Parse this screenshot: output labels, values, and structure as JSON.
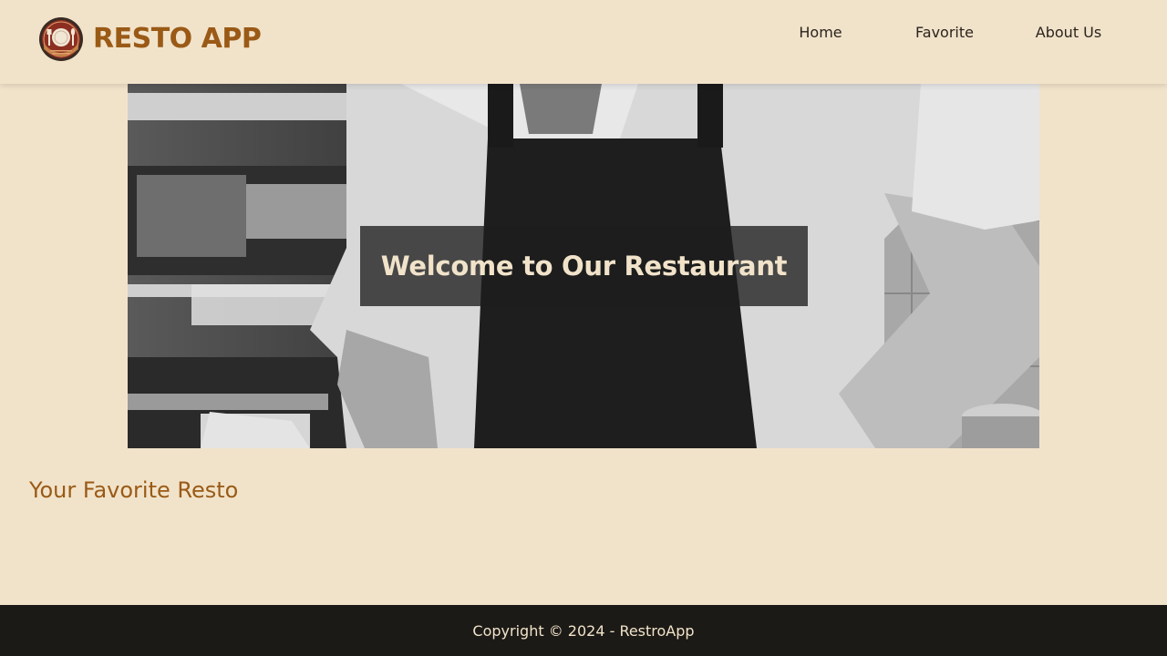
{
  "header": {
    "brand_title": "RESTO APP",
    "nav": [
      {
        "label": "Home"
      },
      {
        "label": "Favorite"
      },
      {
        "label": "About Us"
      }
    ]
  },
  "hero": {
    "title": "Welcome to Our Restaurant"
  },
  "main": {
    "section_title": "Your Favorite Resto"
  },
  "footer": {
    "copyright": "Copyright © 2024 - RestroApp"
  },
  "colors": {
    "background": "#f1e3ca",
    "accent": "#9a5a16",
    "footer_bg": "#1c1a16"
  },
  "icons": {
    "logo": "restaurant-plate-logo-icon"
  }
}
